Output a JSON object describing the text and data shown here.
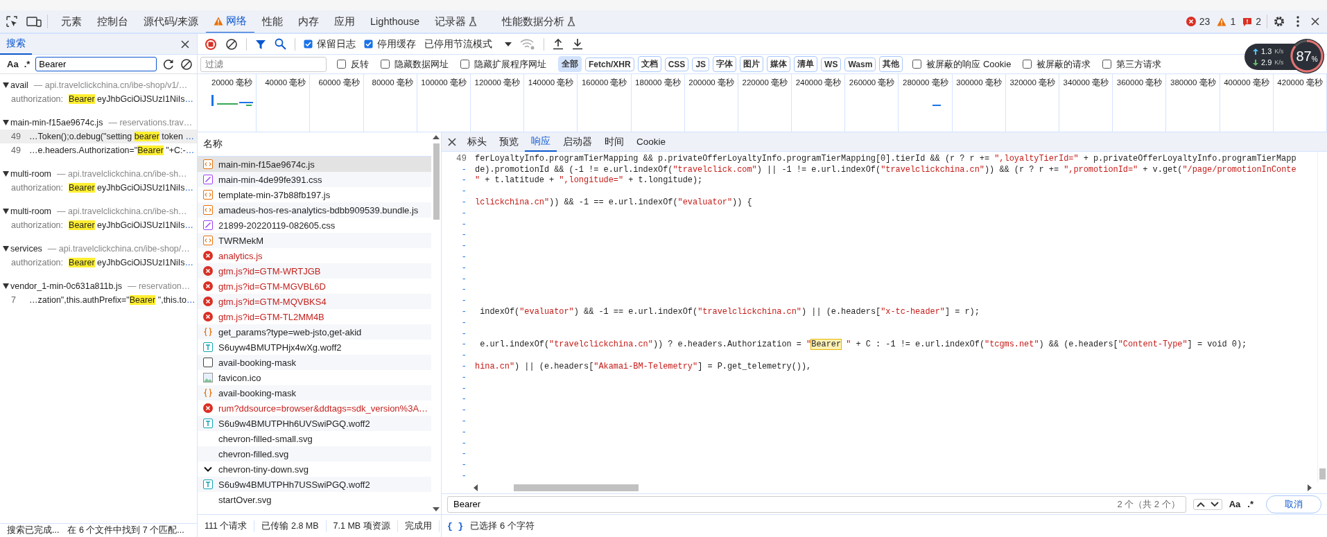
{
  "main_tabs": [
    {
      "label": "元素",
      "selected": false,
      "warning": false,
      "experimental": false
    },
    {
      "label": "控制台",
      "selected": false,
      "warning": false,
      "experimental": false
    },
    {
      "label": "源代码/来源",
      "selected": false,
      "warning": false,
      "experimental": false
    },
    {
      "label": "网络",
      "selected": true,
      "warning": true,
      "experimental": false
    },
    {
      "label": "性能",
      "selected": false,
      "warning": false,
      "experimental": false
    },
    {
      "label": "内存",
      "selected": false,
      "warning": false,
      "experimental": false
    },
    {
      "label": "应用",
      "selected": false,
      "warning": false,
      "experimental": false
    },
    {
      "label": "Lighthouse",
      "selected": false,
      "warning": false,
      "experimental": false
    },
    {
      "label": "记录器",
      "selected": false,
      "warning": false,
      "experimental": true
    },
    {
      "label": "性能数据分析",
      "selected": false,
      "warning": false,
      "experimental": true
    }
  ],
  "counts": {
    "errors": "23",
    "warnings": "1",
    "issues": "2"
  },
  "search_panel": {
    "tab": "搜索",
    "case_label": "Aa",
    "regex_label": ".*",
    "query": "Bearer",
    "results": [
      {
        "file": "avail",
        "url": "— api.travelclickchina.cn/ibe-shop/v1/…",
        "matches": [
          {
            "kind": "header",
            "label": "authorization:",
            "match": "Bearer",
            "after": " eyJhbGciOiJSUzI1NiIs",
            "more": "…",
            "selected": false
          }
        ]
      },
      {
        "file": "main-min-f15ae9674c.js",
        "url": "— reservations.trav…",
        "matches": [
          {
            "kind": "code",
            "line": "49",
            "before": "…Token();o.debug(\"setting ",
            "match": "bearer",
            "after": " token ",
            "more": "…",
            "selected": true
          },
          {
            "kind": "code",
            "line": "49",
            "before": "…e.headers.Authorization=\"",
            "match": "Bearer",
            "after": " \"+C:-",
            "more": "…",
            "selected": false
          }
        ]
      },
      {
        "file": "multi-room",
        "url": "— api.travelclickchina.cn/ibe-sh…",
        "matches": [
          {
            "kind": "header",
            "label": "authorization:",
            "match": "Bearer",
            "after": " eyJhbGciOiJSUzI1NiIs",
            "more": "…",
            "selected": false
          }
        ]
      },
      {
        "file": "multi-room",
        "url": "— api.travelclickchina.cn/ibe-sh…",
        "matches": [
          {
            "kind": "header",
            "label": "authorization:",
            "match": "Bearer",
            "after": " eyJhbGciOiJSUzI1NiIs",
            "more": "…",
            "selected": false
          }
        ]
      },
      {
        "file": "services",
        "url": "— api.travelclickchina.cn/ibe-shop/…",
        "matches": [
          {
            "kind": "header",
            "label": "authorization:",
            "match": "Bearer",
            "after": " eyJhbGciOiJSUzI1NiIs",
            "more": "…",
            "selected": false
          }
        ]
      },
      {
        "file": "vendor_1-min-0c631a811b.js",
        "url": "— reservation…",
        "matches": [
          {
            "kind": "code",
            "line": "7",
            "before": "…zation\",this.authPrefix=\"",
            "match": "Bearer",
            "after": " \",this.to",
            "more": "…",
            "selected": false
          }
        ]
      }
    ],
    "status": "搜索已完成...",
    "summary": "在 6 个文件中找到 7 个匹配..."
  },
  "toolbar": {
    "preserve_log": {
      "label": "保留日志",
      "checked": true
    },
    "disable_cache": {
      "label": "停用缓存",
      "checked": true
    },
    "throttling": "已停用节流模式"
  },
  "filter": {
    "placeholder": "过滤",
    "options": [
      {
        "label": "反转",
        "checked": false
      },
      {
        "label": "隐藏数据网址",
        "checked": false
      },
      {
        "label": "隐藏扩展程序网址",
        "checked": false
      }
    ],
    "types": [
      {
        "label": "全部",
        "selected": true
      },
      {
        "label": "Fetch/XHR",
        "selected": false
      },
      {
        "label": "文档",
        "selected": false
      },
      {
        "label": "CSS",
        "selected": false
      },
      {
        "label": "JS",
        "selected": false
      },
      {
        "label": "字体",
        "selected": false
      },
      {
        "label": "图片",
        "selected": false
      },
      {
        "label": "媒体",
        "selected": false
      },
      {
        "label": "清单",
        "selected": false
      },
      {
        "label": "WS",
        "selected": false
      },
      {
        "label": "Wasm",
        "selected": false
      },
      {
        "label": "其他",
        "selected": false
      }
    ],
    "more_options": [
      {
        "label": "被屏蔽的响应 Cookie",
        "checked": false
      },
      {
        "label": "被屏蔽的请求",
        "checked": false
      },
      {
        "label": "第三方请求",
        "checked": false
      }
    ]
  },
  "overview_ticks": [
    "20000 毫秒",
    "40000 毫秒",
    "60000 毫秒",
    "80000 毫秒",
    "100000 毫秒",
    "120000 毫秒",
    "140000 毫秒",
    "160000 毫秒",
    "180000 毫秒",
    "200000 毫秒",
    "220000 毫秒",
    "240000 毫秒",
    "260000 毫秒",
    "280000 毫秒",
    "300000 毫秒",
    "320000 毫秒",
    "340000 毫秒",
    "360000 毫秒",
    "380000 毫秒",
    "400000 毫秒",
    "420000 毫秒"
  ],
  "requests": {
    "column": "名称",
    "rows": [
      {
        "name": "main-min-f15ae9674c.js",
        "kind": "script",
        "error": false,
        "selected": true
      },
      {
        "name": "main-min-4de99fe391.css",
        "kind": "stylesheet",
        "error": false,
        "selected": false
      },
      {
        "name": "template-min-37b88fb197.js",
        "kind": "script",
        "error": false,
        "selected": false
      },
      {
        "name": "amadeus-hos-res-analytics-bdbb909539.bundle.js",
        "kind": "script",
        "error": false,
        "selected": false
      },
      {
        "name": "21899-20220119-082605.css",
        "kind": "stylesheet",
        "error": false,
        "selected": false
      },
      {
        "name": "TWRMekM",
        "kind": "script",
        "error": false,
        "selected": false
      },
      {
        "name": "analytics.js",
        "error": true,
        "selected": false
      },
      {
        "name": "gtm.js?id=GTM-WRTJGB",
        "error": true,
        "selected": false
      },
      {
        "name": "gtm.js?id=GTM-MGVBL6D",
        "error": true,
        "selected": false
      },
      {
        "name": "gtm.js?id=GTM-MQVBKS4",
        "error": true,
        "selected": false
      },
      {
        "name": "gtm.js?id=GTM-TL2MM4B",
        "error": true,
        "selected": false
      },
      {
        "name": "get_params?type=web-jsto,get-akid",
        "kind": "fetch",
        "error": false,
        "selected": false
      },
      {
        "name": "S6uyw4BMUTPHjx4wXg.woff2",
        "kind": "font",
        "error": false,
        "selected": false
      },
      {
        "name": "avail-booking-mask",
        "kind": "document",
        "error": false,
        "selected": false
      },
      {
        "name": "favicon.ico",
        "kind": "image",
        "error": false,
        "selected": false
      },
      {
        "name": "avail-booking-mask",
        "kind": "fetch",
        "error": false,
        "selected": false
      },
      {
        "name": "rum?ddsource=browser&ddtags=sdk_version%3A…",
        "error": true,
        "selected": false
      },
      {
        "name": "S6u9w4BMUTPHh6UVSwiPGQ.woff2",
        "kind": "font",
        "error": false,
        "selected": false
      },
      {
        "name": "chevron-filled-small.svg",
        "kind": "blank",
        "error": false,
        "selected": false
      },
      {
        "name": "chevron-filled.svg",
        "kind": "blank",
        "error": false,
        "selected": false
      },
      {
        "name": "chevron-tiny-down.svg",
        "kind": "chevron",
        "error": false,
        "selected": false
      },
      {
        "name": "S6u9w4BMUTPHh7USSwiPGQ.woff2",
        "kind": "font",
        "error": false,
        "selected": false
      },
      {
        "name": "startOver.svg",
        "kind": "blank",
        "error": false,
        "selected": false
      }
    ],
    "summary": [
      "111 个请求",
      "已传输 2.8 MB",
      "7.1 MB 项资源",
      "完成用"
    ]
  },
  "detail": {
    "tabs": [
      {
        "label": "标头",
        "selected": false
      },
      {
        "label": "预览",
        "selected": false
      },
      {
        "label": "响应",
        "selected": true
      },
      {
        "label": "启动器",
        "selected": false
      },
      {
        "label": "时间",
        "selected": false
      },
      {
        "label": "Cookie",
        "selected": false
      }
    ],
    "lines": [
      {
        "number": "49",
        "tokens": [
          {
            "kind": "txt",
            "text": "ferLoyaltyInfo.programTierMapping && p.privateOfferLoyaltyInfo.programTierMapping[0].tierId && (r ? r += "
          },
          {
            "kind": "str",
            "text": "\",loyaltyTierId=\""
          },
          {
            "kind": "txt",
            "text": " + p.privateOfferLoyaltyInfo.programTierMapp"
          }
        ]
      },
      {
        "number": "-",
        "tokens": [
          {
            "kind": "txt",
            "text": "de).promotionId && (-1 != e.url.indexOf("
          },
          {
            "kind": "str",
            "text": "\"travelclick.com\""
          },
          {
            "kind": "txt",
            "text": ") || -1 != e.url.indexOf("
          },
          {
            "kind": "str",
            "text": "\"travelclickchina.cn\""
          },
          {
            "kind": "txt",
            "text": ")) && (r ? r += "
          },
          {
            "kind": "str",
            "text": "\",promotionId=\""
          },
          {
            "kind": "txt",
            "text": " + v.get("
          },
          {
            "kind": "str",
            "text": "\"/page/promotionInConte"
          }
        ]
      },
      {
        "number": "-",
        "tokens": [
          {
            "kind": "str",
            "text": "\""
          },
          {
            "kind": "txt",
            "text": " + t.latitude + "
          },
          {
            "kind": "str",
            "text": "\",longitude=\""
          },
          {
            "kind": "txt",
            "text": " + t.longitude);"
          }
        ]
      },
      {
        "number": "-"
      },
      {
        "number": "-",
        "tokens": [
          {
            "kind": "str",
            "text": "lclickchina.cn\""
          },
          {
            "kind": "txt",
            "text": ")) && -1 == e.url.indexOf("
          },
          {
            "kind": "str",
            "text": "\"evaluator\""
          },
          {
            "kind": "txt",
            "text": ")) {"
          }
        ]
      },
      {
        "number": "-"
      },
      {
        "number": "-"
      },
      {
        "number": "-"
      },
      {
        "number": "-"
      },
      {
        "number": "-"
      },
      {
        "number": "-"
      },
      {
        "number": "-"
      },
      {
        "number": "-"
      },
      {
        "number": "-"
      },
      {
        "number": "-",
        "tokens": [
          {
            "kind": "txt",
            "text": " indexOf("
          },
          {
            "kind": "str",
            "text": "\"evaluator\""
          },
          {
            "kind": "txt",
            "text": ") && -1 == e.url.indexOf("
          },
          {
            "kind": "str",
            "text": "\"travelclickchina.cn\""
          },
          {
            "kind": "txt",
            "text": ") || (e.headers["
          },
          {
            "kind": "str",
            "text": "\"x-tc-header\""
          },
          {
            "kind": "txt",
            "text": "] = r);"
          }
        ]
      },
      {
        "number": "-"
      },
      {
        "number": "-"
      },
      {
        "number": "-",
        "tokens": [
          {
            "kind": "txt",
            "text": " e.url.indexOf("
          },
          {
            "kind": "str",
            "text": "\"travelclickchina.cn\""
          },
          {
            "kind": "txt",
            "text": ")) ? e.headers.Authorization = "
          },
          {
            "kind": "str",
            "text": "\""
          },
          {
            "kind": "match",
            "text": "Bearer"
          },
          {
            "kind": "str",
            "text": " \""
          },
          {
            "kind": "txt",
            "text": " + C : -1 != e.url.indexOf("
          },
          {
            "kind": "str",
            "text": "\"tcgms.net\""
          },
          {
            "kind": "txt",
            "text": ") && (e.headers["
          },
          {
            "kind": "str",
            "text": "\"Content-Type\""
          },
          {
            "kind": "txt",
            "text": "] = void 0);"
          }
        ]
      },
      {
        "number": "-"
      },
      {
        "number": "-",
        "tokens": [
          {
            "kind": "str",
            "text": "hina.cn\""
          },
          {
            "kind": "txt",
            "text": ") || (e.headers["
          },
          {
            "kind": "str",
            "text": "\"Akamai-BM-Telemetry\""
          },
          {
            "kind": "txt",
            "text": "] = P.get_telemetry()),"
          }
        ]
      },
      {
        "number": "-"
      },
      {
        "number": "-"
      },
      {
        "number": "-"
      },
      {
        "number": "-"
      },
      {
        "number": "-"
      },
      {
        "number": "-"
      },
      {
        "number": "-"
      },
      {
        "number": "-"
      },
      {
        "number": "-"
      },
      {
        "number": "-"
      }
    ],
    "find": {
      "value": "Bearer",
      "count": "2 个（共 2 个）",
      "case_label": "Aa",
      "regex_label": ".*",
      "cancel": "取消"
    },
    "status": {
      "format_label": "{ }",
      "text": "已选择 6 个字符"
    }
  },
  "speed_meter": {
    "up": "1.3",
    "up_unit": "K/s",
    "down": "2.9",
    "down_unit": "K/s",
    "percent": "87",
    "percent_sign": "%"
  }
}
